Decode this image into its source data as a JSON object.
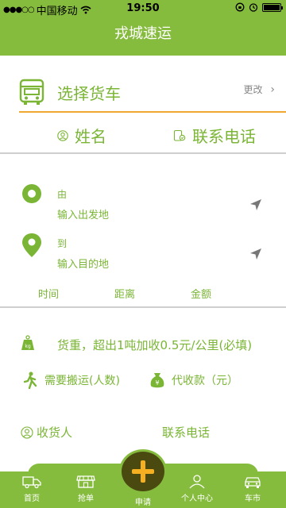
{
  "status_bar": {
    "carrier": "中国移动",
    "time": "19:50"
  },
  "header": {
    "title": "戎城速运"
  },
  "truck": {
    "label": "选择货车",
    "change_label": "更改"
  },
  "contact": {
    "name_label": "姓名",
    "phone_label": "联系电话"
  },
  "route": {
    "from_label": "由",
    "from_placeholder": "输入出发地",
    "to_label": "到",
    "to_placeholder": "输入目的地"
  },
  "metrics": {
    "time_label": "时间",
    "distance_label": "距离",
    "amount_label": "金额"
  },
  "cargo": {
    "weight_text": "货重，超出1吨加收0.5元/公里(必填)",
    "movers_label": "需要搬运(人数)",
    "cod_label": "代收款（元）"
  },
  "receiver": {
    "name_label": "收货人",
    "phone_label": "联系电话"
  },
  "tabs": {
    "home": "首页",
    "grab": "抢单",
    "apply": "申请",
    "profile": "个人中心",
    "market": "车市"
  },
  "colors": {
    "brand_green": "#86bc3e",
    "accent_orange": "#f0a830",
    "plus_dark": "#4a4a10",
    "plus_yellow": "#f4b021"
  },
  "icons": {
    "truck": "truck-icon",
    "person": "person-icon",
    "phone": "phone-icon",
    "location": "location-pin-icon",
    "navigation": "navigation-arrow-icon",
    "weight": "weight-icon",
    "walker": "walking-person-icon",
    "money_bag": "money-bag-icon",
    "plus": "plus-icon"
  }
}
